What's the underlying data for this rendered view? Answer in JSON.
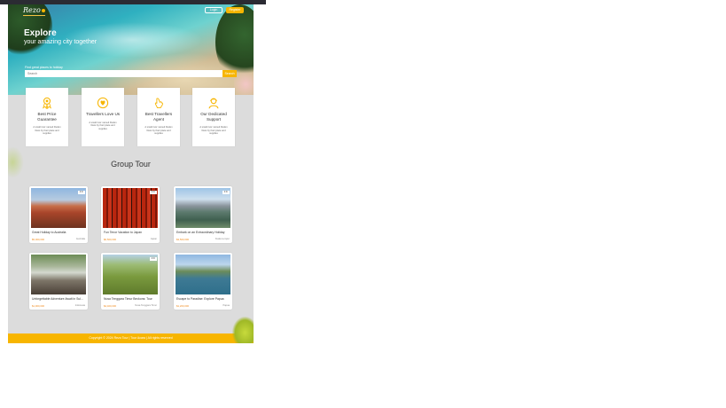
{
  "header": {
    "logo_text": "Rezo",
    "login_label": "Login",
    "register_label": "Register"
  },
  "hero": {
    "title": "Explore",
    "subtitle": "your amazing city together",
    "search_label": "Find great places to holiday",
    "search_placeholder": "Search",
    "search_button": "Search"
  },
  "features": [
    {
      "icon": "medal-icon",
      "title": "Best Price Guarantee",
      "desc": "A small river named Duden flows by their place and supplies"
    },
    {
      "icon": "heart-hands-icon",
      "title": "Travellers Love Us",
      "desc": "A small river named Duden flows by their place and supplies"
    },
    {
      "icon": "agent-icon",
      "title": "Best Travellers Agent",
      "desc": "A small river named Duden flows by their place and supplies"
    },
    {
      "icon": "support-icon",
      "title": "Our Dedicated Support",
      "desc": "A small river named Duden flows by their place and supplies"
    }
  ],
  "section": {
    "title": "Group Tour"
  },
  "tours": [
    {
      "image": "uluru",
      "badge": "4 hr",
      "title": "Great Holiday to Australia",
      "price": "$5,000,000",
      "location": "Australia"
    },
    {
      "image": "torii",
      "badge": "4 hr",
      "title": "Fun Tenor Vacation to Japan",
      "price": "$6,500,000",
      "location": "Japan"
    },
    {
      "image": "city",
      "badge": "4 hr",
      "title": "Embark on an Extraordinary Holiday",
      "price": "$3,500,000",
      "location": "Kuala Lumpur"
    },
    {
      "image": "ruins",
      "badge": "",
      "title": "Unforgettable Adventure Await in Sulawesi",
      "price": "$1,900,000",
      "location": "Indonesia"
    },
    {
      "image": "hills",
      "badge": "4 hr",
      "title": "Nusa Tenggara Timur Beckons: Tour",
      "price": "$4,400,000",
      "location": "Nusa Tenggara Timur"
    },
    {
      "image": "lake",
      "badge": "",
      "title": "Escape to Paradise: Explore Papua",
      "price": "$1,200,000",
      "location": "Papua"
    }
  ],
  "footer": {
    "text": "Copyright © 2024 Rezo Tour | Tour Acara | All rights reserved"
  },
  "colors": {
    "accent": "#f7b500",
    "price": "#f08a1c"
  }
}
